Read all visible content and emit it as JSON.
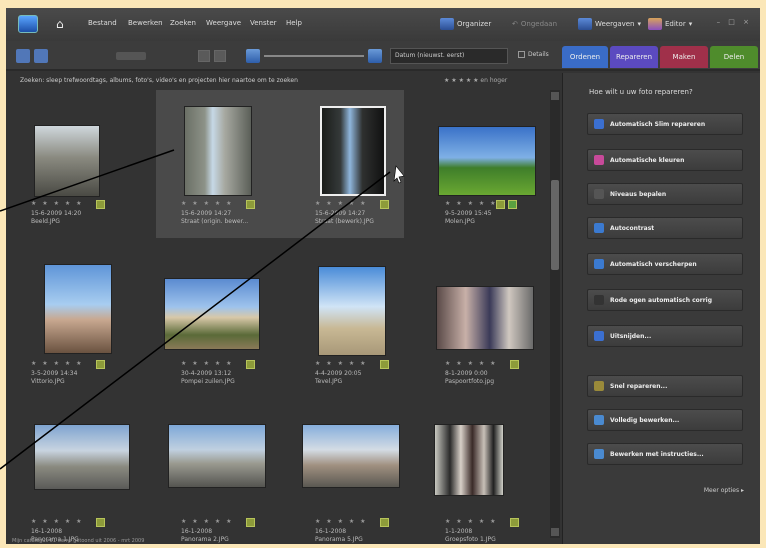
{
  "menubar": {
    "items": [
      "Bestand",
      "Bewerken",
      "Zoeken",
      "Weergave",
      "Venster",
      "Help"
    ],
    "organizer_label": "Organizer",
    "undo_label": "Ongedaan",
    "workspace_label": "Weergaven",
    "editor_label": "Editor",
    "window_controls": "– □ ×"
  },
  "toolbar": {
    "sort_label": "Datum (nieuwst. eerst)",
    "details_label": "Details",
    "tabs": [
      {
        "label": "Ordenen",
        "color": "#3a6cc7"
      },
      {
        "label": "Repareren",
        "color": "#5b4ac0"
      },
      {
        "label": "Maken",
        "color": "#a0304a"
      },
      {
        "label": "Delen",
        "color": "#4f8c2c"
      }
    ]
  },
  "status": {
    "hint": "Zoeken: sleep trefwoordtags, albums, foto's, video's en projecten hier naartoe om te zoeken",
    "rating_filter": "★ ★ ★ ★ ★ en hoger"
  },
  "photos": [
    {
      "date": "15-6-2009 14:20",
      "file": "Beeld.JPG",
      "selected": false
    },
    {
      "date": "15-6-2009 14:27",
      "file": "Straat (origin. bewer...",
      "selected": true
    },
    {
      "date": "15-6-2009 14:27",
      "file": "Straat (bewerk).JPG",
      "selected": true
    },
    {
      "date": "9-5-2009 15:45",
      "file": "Molen.JPG",
      "selected": false
    },
    {
      "date": "3-5-2009 14:34",
      "file": "Vittorio.JPG",
      "selected": false
    },
    {
      "date": "30-4-2009 13:12",
      "file": "Pompei zuilen.JPG",
      "selected": false
    },
    {
      "date": "4-4-2009 20:05",
      "file": "Tevel.JPG",
      "selected": false
    },
    {
      "date": "8-1-2009 0:00",
      "file": "Paspoortfoto.jpg",
      "selected": false
    },
    {
      "date": "16-1-2008",
      "file": "Panorama 1.JPG",
      "selected": false
    },
    {
      "date": "16-1-2008",
      "file": "Panorama 2.JPG",
      "selected": false
    },
    {
      "date": "16-1-2008",
      "file": "Panorama 5.JPG",
      "selected": false
    },
    {
      "date": "1-1-2008",
      "file": "Groepsfoto 1.JPG",
      "selected": false
    }
  ],
  "panel": {
    "question": "Hoe wilt u uw foto repareren?",
    "buttons": [
      {
        "label": "Automatisch Slim repareren",
        "icon": "wand-icon",
        "color": "#3b6fd0"
      },
      {
        "label": "Automatische kleuren",
        "icon": "color-wheel-icon",
        "color": "#c84a9a"
      },
      {
        "label": "Niveaus bepalen",
        "icon": "levels-icon",
        "color": "#555555"
      },
      {
        "label": "Autocontrast",
        "icon": "contrast-icon",
        "color": "#3b7ad0"
      },
      {
        "label": "Automatisch verscherpen",
        "icon": "sharpen-icon",
        "color": "#3b7ad0"
      },
      {
        "label": "Rode ogen automatisch corrig",
        "icon": "eye-icon",
        "color": "#333333"
      },
      {
        "label": "Uitsnijden...",
        "icon": "crop-icon",
        "color": "#3b6fd0"
      },
      {
        "label": "Snel repareren...",
        "icon": "quick-fix-icon",
        "color": "#9a8a3a"
      },
      {
        "label": "Volledig bewerken...",
        "icon": "edit-icon",
        "color": "#4a8ad0"
      },
      {
        "label": "Bewerken met instructies...",
        "icon": "guided-edit-icon",
        "color": "#4a8ad0"
      }
    ],
    "more_label": "Meer opties ▸"
  },
  "footer": "Mijn catalogus   51 items getoond uit 2006 - mrt 2009"
}
